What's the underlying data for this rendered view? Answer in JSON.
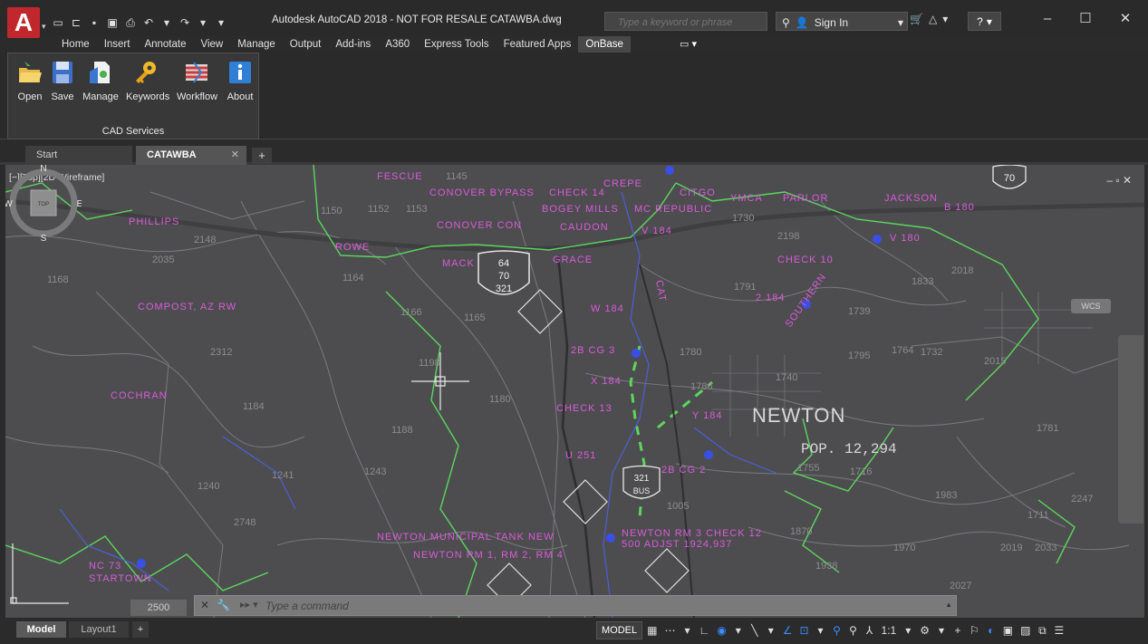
{
  "app": {
    "logo_letter": "A",
    "window_title": "Autodesk AutoCAD 2018 - NOT FOR RESALE    CATAWBA.dwg"
  },
  "search": {
    "placeholder": "Type a keyword or phrase"
  },
  "account": {
    "signin_label": "Sign In"
  },
  "ribbon_tabs": [
    {
      "label": "Home"
    },
    {
      "label": "Insert"
    },
    {
      "label": "Annotate"
    },
    {
      "label": "View"
    },
    {
      "label": "Manage"
    },
    {
      "label": "Output"
    },
    {
      "label": "Add-ins"
    },
    {
      "label": "A360"
    },
    {
      "label": "Express Tools"
    },
    {
      "label": "Featured Apps"
    },
    {
      "label": "OnBase"
    }
  ],
  "ribbon_panel": {
    "title": "CAD Services",
    "buttons": [
      {
        "label": "Open",
        "icon": "open-folder-icon"
      },
      {
        "label": "Save",
        "icon": "save-disk-icon"
      },
      {
        "label": "Manage",
        "icon": "manage-document-icon"
      },
      {
        "label": "Keywords",
        "icon": "key-icon"
      },
      {
        "label": "Workflow",
        "icon": "workflow-icon"
      },
      {
        "label": "About",
        "icon": "info-icon"
      }
    ]
  },
  "file_tabs": [
    {
      "label": "Start"
    },
    {
      "label": "CATAWBA"
    }
  ],
  "viewport": {
    "label": "[−][Top][2D Wireframe]",
    "controls": "– ▫ ✕",
    "viewcube": {
      "north": "N",
      "south": "S",
      "east": "E",
      "west": "W",
      "top": "TOP"
    },
    "wcs": "WCS"
  },
  "map": {
    "city": "NEWTON",
    "population": "POP. 12,294",
    "route_shields": {
      "us_64": [
        "64",
        "70",
        "321"
      ],
      "us_321_bus": [
        "321",
        "BUS"
      ],
      "i_70": "70"
    },
    "street_labels": [
      "FESCUE",
      "CONOVER BYPASS",
      "CHECK 14",
      "CREPE",
      "CITGO",
      "YMCA",
      "PARLOR",
      "JACKSON",
      "B 180",
      "CONOVER CON",
      "CAUDON",
      "BOGEY MILLS",
      "MC REPUBLIC",
      "PHILLIPS",
      "ROWE",
      "MACK",
      "GRACE",
      "CHECK 10",
      "V 184",
      "V 180",
      "COMPOST, AZ RW",
      "W 184",
      "2 184",
      "CHECK 13",
      "2B CG 3",
      "X 184",
      "Y 184",
      "COCHRAN",
      "U 251",
      "2B CG 2",
      "NEWTON MUNICIPAL TANK NEW",
      "NEWTON RM 3 CHECK 12",
      "NEWTON RM 1, RM 2, RM 4",
      "500 ADJST 1924,937",
      "NC 73",
      "STARTOWN",
      "SOUTHERN",
      "CAT"
    ],
    "elevation_labels": [
      "1145",
      "1150",
      "1152",
      "1153",
      "1164",
      "1166",
      "1165",
      "1168",
      "1184",
      "1198",
      "1180",
      "1188",
      "1243",
      "1241",
      "1240",
      "1730",
      "1732",
      "1739",
      "1764",
      "1786",
      "1795",
      "1780",
      "1791",
      "1833",
      "2015",
      "2018",
      "2019",
      "2027",
      "2033",
      "2035",
      "2148",
      "2198",
      "2247",
      "2312",
      "2748",
      "1005",
      "1970",
      "1983",
      "1938",
      "1870",
      "1716",
      "1740",
      "1755",
      "1711",
      "1781"
    ]
  },
  "command_line": {
    "prompt": "▸▸ ▾",
    "placeholder": "Type a command",
    "scale": "2500"
  },
  "layout_tabs": [
    {
      "label": "Model"
    },
    {
      "label": "Layout1"
    }
  ],
  "status_bar": {
    "model_label": "MODEL",
    "annotation_scale": "1:1"
  },
  "colors": {
    "viewport_bg": "#4d4d50",
    "map_road": "#5cd65c",
    "map_label": "#d95ad9",
    "map_elevation": "#8c8c8c",
    "map_water": "#4b5fd8",
    "logo_red": "#c0282d"
  }
}
